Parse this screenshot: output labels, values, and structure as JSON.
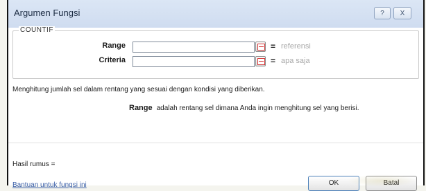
{
  "dialog": {
    "title": "Argumen Fungsi",
    "help_button": "?",
    "close_button": "X"
  },
  "function": {
    "name": "COUNTIF",
    "arguments": [
      {
        "label": "Range",
        "value": "",
        "equals": "=",
        "hint": "referensi"
      },
      {
        "label": "Criteria",
        "value": "",
        "equals": "=",
        "hint": "apa saja"
      }
    ]
  },
  "description": "Menghitung jumlah sel dalam rentang yang sesuai dengan kondisi yang diberikan.",
  "argument_help": {
    "name": "Range",
    "text": "adalah rentang sel dimana Anda ingin menghitung sel yang berisi."
  },
  "result": {
    "label": "Hasil rumus ="
  },
  "help_link": "Bantuan untuk fungsi ini",
  "buttons": {
    "ok": "OK",
    "cancel": "Batal"
  }
}
